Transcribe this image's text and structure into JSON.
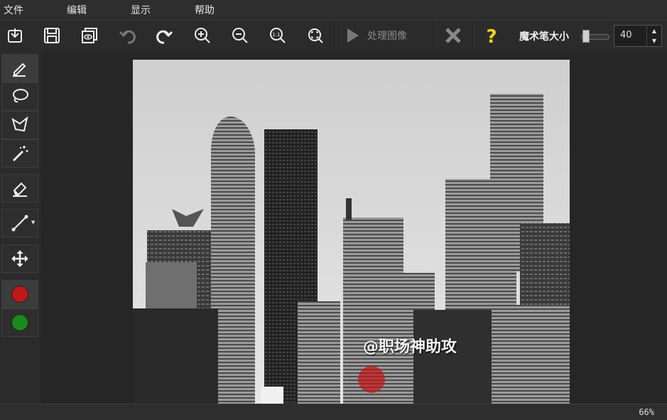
{
  "menu": {
    "file": "文件",
    "edit": "编辑",
    "view": "显示",
    "help": "帮助"
  },
  "toolbar": {
    "icons": [
      "import-icon",
      "save-icon",
      "preview-icon",
      "undo-icon",
      "redo-icon",
      "zoom-in-icon",
      "zoom-out-icon",
      "actual-size-icon",
      "fit-screen-icon"
    ],
    "process_label": "处理图像",
    "brush_size_label": "魔术笔大小",
    "brush_size_value": "40"
  },
  "tools": [
    "brush-icon",
    "lasso-icon",
    "polygon-lasso-icon",
    "magic-wand-icon",
    "eraser-icon",
    "line-icon",
    "move-icon"
  ],
  "colors": {
    "marker_red": "#c0181a",
    "marker_green": "#1a8a1a"
  },
  "canvas": {
    "watermark": "@职场神助攻"
  },
  "status": {
    "zoom": "66%"
  }
}
